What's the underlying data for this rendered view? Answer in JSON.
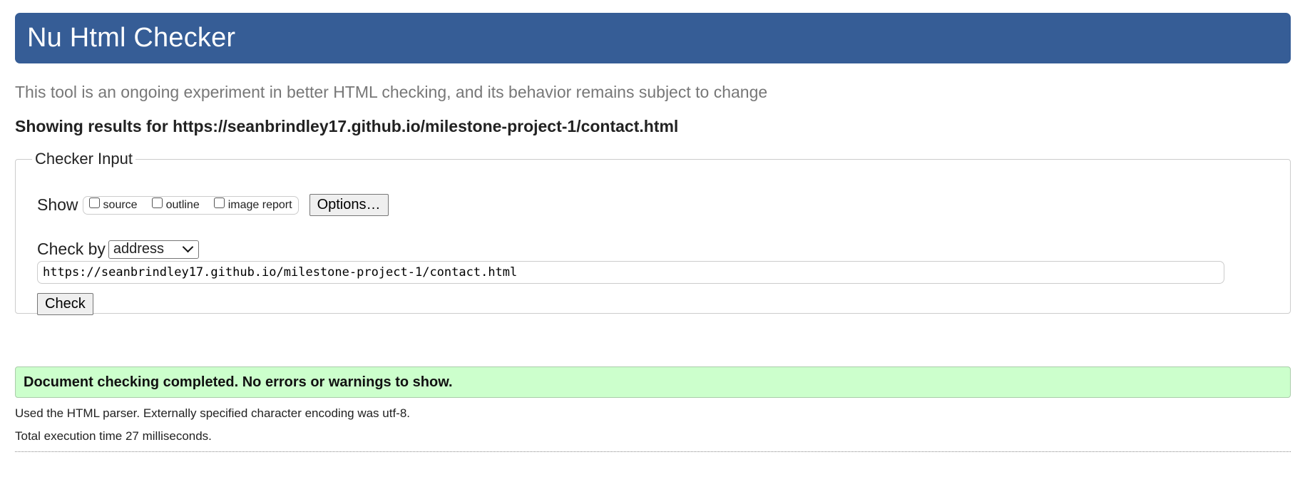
{
  "header": {
    "title": "Nu Html Checker"
  },
  "tagline": "This tool is an ongoing experiment in better HTML checking, and its behavior remains subject to change",
  "results_for": "Showing results for https://seanbrindley17.github.io/milestone-project-1/contact.html",
  "checker_input": {
    "legend": "Checker Input",
    "show_label": "Show",
    "checkboxes": [
      {
        "label": "source",
        "checked": false
      },
      {
        "label": "outline",
        "checked": false
      },
      {
        "label": "image report",
        "checked": false
      }
    ],
    "options_label": "Options…",
    "check_by_label": "Check by",
    "check_by_value": "address",
    "url_value": "https://seanbrindley17.github.io/milestone-project-1/contact.html",
    "check_label": "Check"
  },
  "result": {
    "success_message": "Document checking completed. No errors or warnings to show.",
    "parser_info": "Used the HTML parser. Externally specified character encoding was utf-8.",
    "execution_time": "Total execution time 27 milliseconds."
  },
  "colors": {
    "header_bg": "#365d96",
    "success_bg": "#ccffcc"
  }
}
